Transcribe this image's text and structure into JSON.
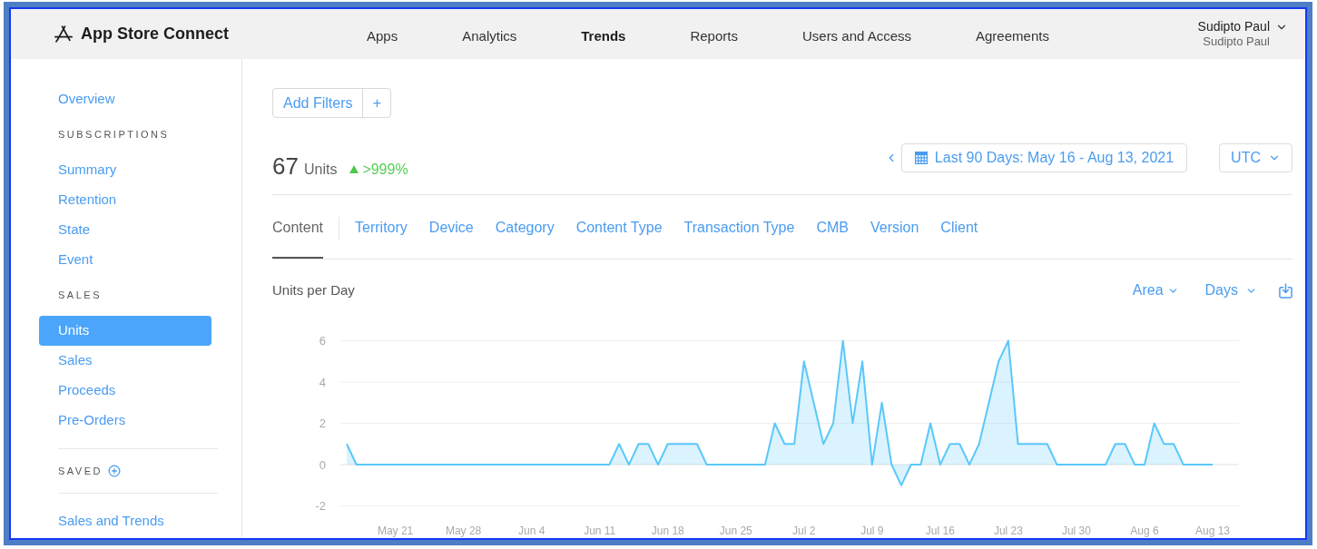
{
  "header": {
    "logo": "App Store Connect",
    "nav": [
      {
        "label": "Apps",
        "selected": false
      },
      {
        "label": "Analytics",
        "selected": false
      },
      {
        "label": "Trends",
        "selected": true
      },
      {
        "label": "Reports",
        "selected": false
      },
      {
        "label": "Users and Access",
        "selected": false
      },
      {
        "label": "Agreements",
        "selected": false
      }
    ],
    "account": {
      "name": "Sudipto Paul",
      "subtitle": "Sudipto Paul"
    }
  },
  "sidebar": {
    "items": [
      {
        "kind": "link",
        "label": "Overview",
        "selected": false
      },
      {
        "kind": "heading",
        "label": "SUBSCRIPTIONS"
      },
      {
        "kind": "link",
        "label": "Summary",
        "selected": false
      },
      {
        "kind": "link",
        "label": "Retention",
        "selected": false
      },
      {
        "kind": "link",
        "label": "State",
        "selected": false
      },
      {
        "kind": "link",
        "label": "Event",
        "selected": false
      },
      {
        "kind": "heading",
        "label": "SALES"
      },
      {
        "kind": "link",
        "label": "Units",
        "selected": true
      },
      {
        "kind": "link",
        "label": "Sales",
        "selected": false
      },
      {
        "kind": "link",
        "label": "Proceeds",
        "selected": false
      },
      {
        "kind": "link",
        "label": "Pre-Orders",
        "selected": false
      },
      {
        "kind": "divider"
      },
      {
        "kind": "add_heading",
        "label": "SAVED"
      },
      {
        "kind": "divider"
      },
      {
        "kind": "link",
        "label": "Sales and Trends",
        "selected": false
      }
    ]
  },
  "filters": {
    "label": "Add Filters",
    "add": "+"
  },
  "summary": {
    "value": "67",
    "unit": "Units",
    "increase": true,
    "change": ">999%"
  },
  "date_range": {
    "label": "Last 90 Days: May 16 - Aug 13, 2021"
  },
  "timezone": {
    "label": "UTC"
  },
  "tabs": [
    {
      "label": "Content",
      "selected": true
    },
    {
      "label": "Territory",
      "selected": false
    },
    {
      "label": "Device",
      "selected": false
    },
    {
      "label": "Category",
      "selected": false
    },
    {
      "label": "Content Type",
      "selected": false
    },
    {
      "label": "Transaction Type",
      "selected": false
    },
    {
      "label": "CMB",
      "selected": false
    },
    {
      "label": "Version",
      "selected": false
    },
    {
      "label": "Client",
      "selected": false
    }
  ],
  "chart_panel": {
    "type_menu": "Area",
    "period_menu": "Days",
    "chart_data": {
      "type": "area",
      "title": "Units per Day",
      "categories": [
        null,
        null,
        null,
        null,
        null,
        "May 21",
        null,
        null,
        null,
        null,
        null,
        null,
        "May 28",
        null,
        null,
        null,
        null,
        null,
        null,
        "Jun 4",
        null,
        null,
        null,
        null,
        null,
        null,
        "Jun 11",
        null,
        null,
        null,
        null,
        null,
        null,
        "Jun 18",
        null,
        null,
        null,
        null,
        null,
        null,
        "Jun 25",
        null,
        null,
        null,
        null,
        null,
        null,
        "Jul 2",
        null,
        null,
        null,
        null,
        null,
        null,
        "Jul 9",
        null,
        null,
        null,
        null,
        null,
        null,
        "Jul 16",
        null,
        null,
        null,
        null,
        null,
        null,
        "Jul 23",
        null,
        null,
        null,
        null,
        null,
        null,
        "Jul 30",
        null,
        null,
        null,
        null,
        null,
        null,
        "Aug 6",
        null,
        null,
        null,
        null,
        null,
        null,
        "Aug 13"
      ],
      "series": [
        {
          "color": "#5ac8fa",
          "values": [
            1,
            0,
            0,
            0,
            0,
            0,
            0,
            0,
            0,
            0,
            0,
            0,
            0,
            0,
            0,
            0,
            0,
            0,
            0,
            0,
            0,
            0,
            0,
            0,
            0,
            0,
            0,
            0,
            1,
            0,
            1,
            1,
            0,
            1,
            1,
            1,
            1,
            0,
            0,
            0,
            0,
            0,
            0,
            0,
            2,
            1,
            1,
            5,
            3,
            1,
            2,
            6,
            2,
            5,
            0,
            3,
            0,
            -1,
            0,
            0,
            2,
            0,
            1,
            1,
            0,
            1,
            3,
            5,
            6,
            1,
            1,
            1,
            1,
            0,
            0,
            0,
            0,
            0,
            0,
            1,
            1,
            0,
            0,
            2,
            1,
            1,
            0,
            0,
            0,
            0
          ]
        }
      ],
      "ylim": [
        -2,
        6
      ],
      "yticks": [
        -2,
        0,
        2,
        4,
        6
      ],
      "grid": true
    }
  }
}
